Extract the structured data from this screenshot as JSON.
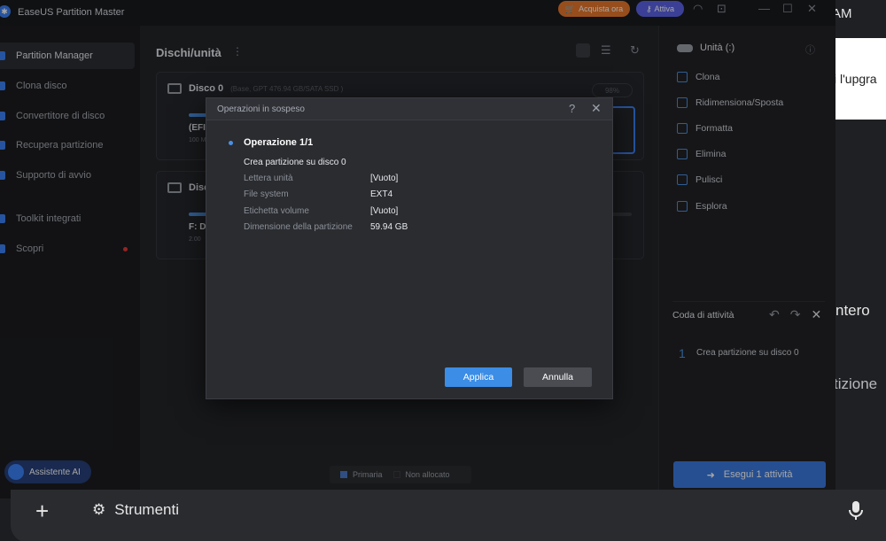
{
  "app": {
    "title": "EaseUS Partition Master",
    "buy_label": "Acquista ora",
    "activate_label": "Attiva"
  },
  "sidebar": {
    "items": [
      {
        "label": "Partition Manager",
        "active": true
      },
      {
        "label": "Clona disco"
      },
      {
        "label": "Convertitore di disco"
      },
      {
        "label": "Recupera partizione"
      },
      {
        "label": "Supporto di avvio"
      },
      {
        "label": "Toolkit integrati"
      },
      {
        "label": "Scopri",
        "badge": "red-dot"
      }
    ],
    "ai_label": "Assistente AI"
  },
  "main": {
    "title": "Dischi/unità",
    "disk0": {
      "name": "Disco 0",
      "info": "(Base, GPT 476.94 GB/SATA SSD )",
      "usage_badge": "98%",
      "partition_label": "(EFI",
      "partition_size": "100 M"
    },
    "disk1": {
      "name": "Disc",
      "partition_label": "F: D",
      "partition_size": "2.00"
    },
    "legend": {
      "primary": "Primaria",
      "unallocated": "Non allocato"
    }
  },
  "actions": {
    "unit_title": "Unità (:)",
    "items": [
      "Clona",
      "Ridimensiona/Sposta",
      "Formatta",
      "Elimina",
      "Pulisci",
      "Esplora"
    ],
    "queue_title": "Coda di attività",
    "queue_items": [
      {
        "num": "1",
        "label": "Crea partizione su disco 0"
      }
    ],
    "run_label": "Esegui 1 attività"
  },
  "dialog": {
    "title": "Operazioni in sospeso",
    "op_title": "Operazione 1/1",
    "op_desc": "Crea partizione su disco 0",
    "rows": [
      {
        "key": "Lettera unità",
        "value": "[Vuoto]"
      },
      {
        "key": "File system",
        "value": "EXT4"
      },
      {
        "key": "Etichetta volume",
        "value": "[Vuoto]"
      },
      {
        "key": "Dimensione della partizione",
        "value": "59.94 GB"
      }
    ],
    "apply_label": "Applica",
    "cancel_label": "Annulla"
  },
  "background": {
    "am_text": "AM",
    "upgrade_text": "i l'upgra",
    "ntero_text": "ntero",
    "tizione_text": "tizione"
  },
  "bottom_bar": {
    "tools_label": "Strumenti"
  },
  "colors": {
    "accent": "#3b82f6",
    "buy": "#e8782b",
    "activate": "#5b63e6",
    "run": "#3b7ae0"
  }
}
